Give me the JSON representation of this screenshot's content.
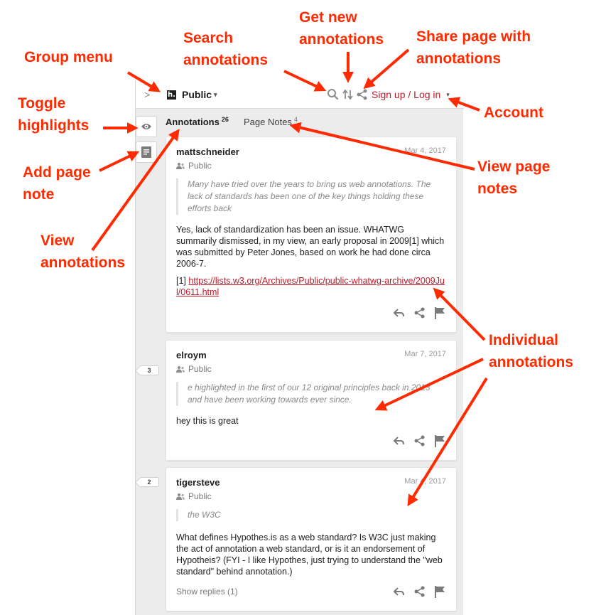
{
  "sidebar": {
    "collapse_glyph": ">",
    "logo_glyph": "h.",
    "group_name": "Public",
    "group_caret": "▾",
    "account_label": "Sign up / Log in",
    "account_caret": "▾",
    "icons": [
      "search-icon",
      "refresh-icon",
      "share-icon",
      "eye-icon",
      "page-note-icon",
      "reply-icon",
      "flag-icon",
      "group-icon"
    ],
    "tabs": {
      "annotations_label": "Annotations",
      "annotations_count": "26",
      "notes_label": "Page Notes",
      "notes_count": "4"
    }
  },
  "annotations": [
    {
      "user": "mattschneider",
      "date": "Mar 4, 2017",
      "visibility": "Public",
      "quote": "Many have tried over the years to bring us web annotations. The lack of standards has been one of the key things holding these efforts back",
      "body": "Yes, lack of standardization has been an issue. WHATWG summarily dismissed, in my view, an early proposal in 2009[1] which was submitted by Peter Jones, based on work he had done circa 2006-7.",
      "link_prefix": "[1] ",
      "link": "https://lists.w3.org/Archives/Public/public-whatwg-archive/2009Jul/0611.html"
    },
    {
      "user": "elroym",
      "date": "Mar 7, 2017",
      "visibility": "Public",
      "quote": "e highlighted in the first of our 12 original principles back in 2013 and have been working towards ever since.",
      "body": "hey this is great",
      "bubble": "3"
    },
    {
      "user": "tigersteve",
      "date": "Mar 4, 2017",
      "visibility": "Public",
      "quote": "the W3C",
      "body": "What defines Hypothes.is as a web standard? Is W3C just making the act of annotation a web standard, or is it an endorsement of Hypotheis? (FYI - I like Hypothes, just trying to understand the \"web standard\" behind annotation.)",
      "replies": "Show replies (1)",
      "bubble": "2"
    }
  ],
  "callouts": {
    "group_menu": "Group menu",
    "search": "Search\nannotations",
    "get_new": "Get new\nannotations",
    "share_page": "Share page with\nannotations",
    "toggle_highlights": "Toggle\nhighlights",
    "account": "Account",
    "add_page_note": "Add page\nnote",
    "view_page_notes": "View page\nnotes",
    "view_annotations": "View\nannotations",
    "individual_annotations": "Individual\nannotations"
  },
  "colors": {
    "callout": "#ff2a00",
    "brand_red": "#bd1c2b",
    "sidebar_bg": "#ececec"
  }
}
